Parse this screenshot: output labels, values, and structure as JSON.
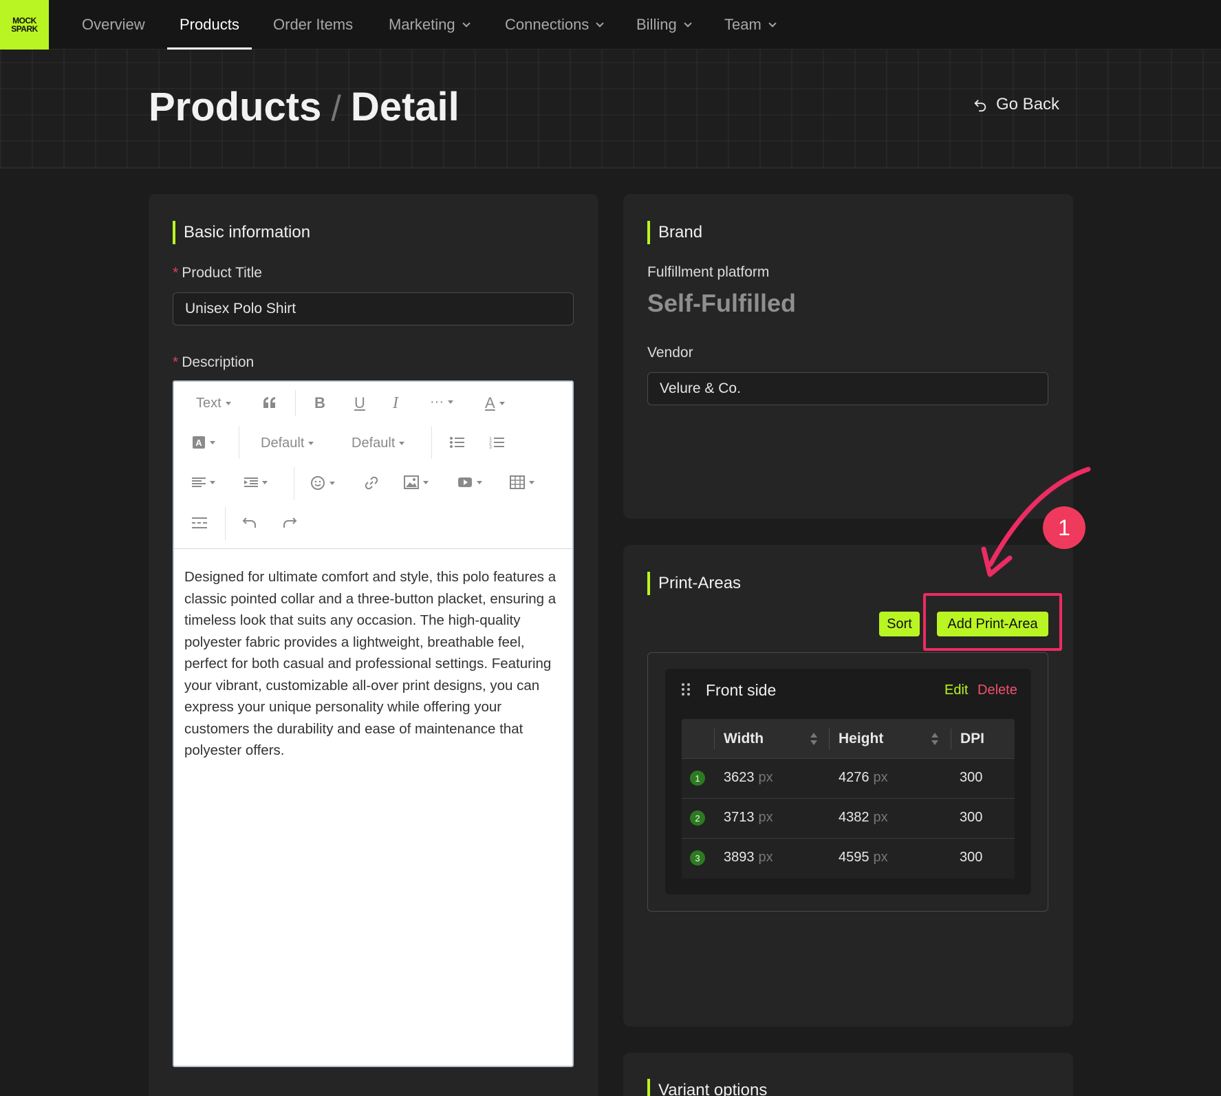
{
  "brand": {
    "logo_line1": "MOCK",
    "logo_line2": "SPARK"
  },
  "nav": {
    "items": [
      {
        "label": "Overview",
        "dropdown": false
      },
      {
        "label": "Products",
        "dropdown": false,
        "active": true
      },
      {
        "label": "Order Items",
        "dropdown": false
      },
      {
        "label": "Marketing",
        "dropdown": true
      },
      {
        "label": "Connections",
        "dropdown": true
      },
      {
        "label": "Billing",
        "dropdown": true
      },
      {
        "label": "Team",
        "dropdown": true
      }
    ]
  },
  "header": {
    "crumb_parent": "Products",
    "crumb_sep": "/",
    "crumb_current": "Detail",
    "go_back": "Go Back"
  },
  "basic": {
    "title": "Basic information",
    "product_title_label": "Product Title",
    "product_title_value": "Unisex Polo Shirt",
    "description_label": "Description",
    "required_mark": "*",
    "toolbar": {
      "text": "Text",
      "default1": "Default",
      "default2": "Default",
      "more": "···"
    },
    "description": "Designed for ultimate comfort and style, this polo features a classic pointed collar and a three-button placket, ensuring a timeless look that suits any occasion. The high-quality polyester fabric provides a lightweight, breathable feel, perfect for both casual and professional settings. Featuring your vibrant, customizable all-over print designs, you can express your unique personality while offering your customers the durability and ease of maintenance that polyester offers."
  },
  "brand_card": {
    "title": "Brand",
    "fulfillment_label": "Fulfillment platform",
    "fulfillment_value": "Self-Fulfilled",
    "vendor_label": "Vendor",
    "vendor_value": "Velure & Co."
  },
  "print_areas": {
    "title": "Print-Areas",
    "sort_label": "Sort",
    "add_label": "Add Print-Area",
    "step_badge": "1",
    "area": {
      "name": "Front side",
      "edit": "Edit",
      "delete": "Delete",
      "columns": [
        "Width",
        "Height",
        "DPI"
      ],
      "unit": "px",
      "rows": [
        {
          "n": "1",
          "width": "3623",
          "height": "4276",
          "dpi": "300"
        },
        {
          "n": "2",
          "width": "3713",
          "height": "4382",
          "dpi": "300"
        },
        {
          "n": "3",
          "width": "3893",
          "height": "4595",
          "dpi": "300"
        }
      ]
    }
  },
  "variant": {
    "title": "Variant options"
  },
  "colors": {
    "accent": "#b9f522",
    "danger": "#f0506e",
    "annotation": "#ec2c63",
    "background": "#1c1c1c",
    "card": "#252525"
  }
}
